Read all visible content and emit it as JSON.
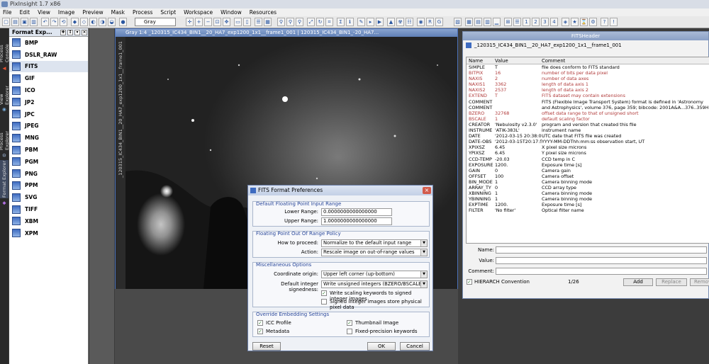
{
  "app": {
    "title": "PixInsight 1.7 x86"
  },
  "menu": [
    "File",
    "Edit",
    "View",
    "Image",
    "Preview",
    "Mask",
    "Process",
    "Script",
    "Workspace",
    "Window",
    "Resources"
  ],
  "toolbar": {
    "view_selector": "Gray"
  },
  "side_tabs": [
    "Process Console",
    "View Explorer",
    "Process Explorer",
    "Format Explorer"
  ],
  "format_explorer": {
    "title": "Format Exp...",
    "items": [
      "BMP",
      "DSLR_RAW",
      "FITS",
      "GIF",
      "ICO",
      "JP2",
      "JPC",
      "JPEG",
      "MNG",
      "PBM",
      "PGM",
      "PNG",
      "PPM",
      "SVG",
      "TIFF",
      "XBM",
      "XPM"
    ],
    "selected": "FITS"
  },
  "image_window": {
    "title": "Gray 1:4 _120315_IC434_BIN1__20_HA7_exp1200_1x1__frame1_001 | 120315_IC434_BIN1_-20_HA7...",
    "side_label": "_120315_IC434_BIN1__20_HA7_exp1200_1x1__frame1_001"
  },
  "fits_header": {
    "title": "FITSHeader",
    "file": "_120315_IC434_BIN1__20_HA7_exp1200_1x1__frame1_001",
    "columns": [
      "Name",
      "Value",
      "Comment"
    ],
    "rows": [
      {
        "name": "SIMPLE",
        "value": "T",
        "comment": "file does conform to FITS standard",
        "reserved": false
      },
      {
        "name": "BITPIX",
        "value": "16",
        "comment": "number of bits per data pixel",
        "reserved": true
      },
      {
        "name": "NAXIS",
        "value": "2",
        "comment": "number of data axes",
        "reserved": true
      },
      {
        "name": "NAXIS1",
        "value": "3362",
        "comment": "length of data axis 1",
        "reserved": true
      },
      {
        "name": "NAXIS2",
        "value": "2537",
        "comment": "length of data axis 2",
        "reserved": true
      },
      {
        "name": "EXTEND",
        "value": "T",
        "comment": "FITS dataset may contain extensions",
        "reserved": true
      },
      {
        "name": "COMMENT",
        "value": "",
        "comment": "FITS (Flexible Image Transport System) format is defined in 'Astronomy",
        "reserved": false
      },
      {
        "name": "COMMENT",
        "value": "",
        "comment": "and Astrophysics', volume 376, page 359; bibcode: 2001A&A...376..359H",
        "reserved": false
      },
      {
        "name": "BZERO",
        "value": "32768",
        "comment": "offset data range to that of unsigned short",
        "reserved": true
      },
      {
        "name": "BSCALE",
        "value": "1",
        "comment": "default scaling factor",
        "reserved": true
      },
      {
        "name": "CREATOR",
        "value": "'Nebulosity v2.3.0'",
        "comment": "program and version that created this file",
        "reserved": false
      },
      {
        "name": "INSTRUME",
        "value": "'ATIK-383L'",
        "comment": "instrument name",
        "reserved": false
      },
      {
        "name": "DATE",
        "value": "'2012-03-15 20:38:05'",
        "comment": "UTC date that FITS file was created",
        "reserved": false
      },
      {
        "name": "DATE-OBS",
        "value": "'2012-03-15T20:17:54'",
        "comment": "YYYY-MM-DDThh:mm:ss observation start, UT",
        "reserved": false
      },
      {
        "name": "XPIXSZ",
        "value": "6.45",
        "comment": "X pixel size microns",
        "reserved": false
      },
      {
        "name": "YPIXSZ",
        "value": "6.45",
        "comment": "Y pixel size microns",
        "reserved": false
      },
      {
        "name": "CCD-TEMP",
        "value": "-20.03",
        "comment": "CCD temp in C",
        "reserved": false
      },
      {
        "name": "EXPOSURE",
        "value": "1200.",
        "comment": "Exposure time [s]",
        "reserved": false
      },
      {
        "name": "GAIN",
        "value": "0",
        "comment": "Camera gain",
        "reserved": false
      },
      {
        "name": "OFFSET",
        "value": "100",
        "comment": "Camera offset",
        "reserved": false
      },
      {
        "name": "BIN_MODE",
        "value": "1",
        "comment": "Camera binning mode",
        "reserved": false
      },
      {
        "name": "ARRAY_TY",
        "value": "0",
        "comment": "CCD array type",
        "reserved": false
      },
      {
        "name": "XBINNING",
        "value": "1",
        "comment": "Camera binning mode",
        "reserved": false
      },
      {
        "name": "YBINNING",
        "value": "1",
        "comment": "Camera binning mode",
        "reserved": false
      },
      {
        "name": "EXPTIME",
        "value": "1200.",
        "comment": "Exposure time [s]",
        "reserved": false
      },
      {
        "name": "FILTER",
        "value": "'No filter'",
        "comment": "Optical filter name",
        "reserved": false
      }
    ],
    "name_label": "Name:",
    "value_label": "Value:",
    "comment_label": "Comment:",
    "hierarch_label": "HIERARCH Convention",
    "hierarch_checked": true,
    "page": "1/26",
    "add_label": "Add",
    "replace_label": "Replace",
    "remove_label": "Remov"
  },
  "prefs": {
    "title": "FITS Format Preferences",
    "float_input": {
      "title": "Default Floating Point Input Range",
      "lower_label": "Lower Range:",
      "lower_value": "0.0000000000000000",
      "upper_label": "Upper Range:",
      "upper_value": "1.0000000000000000"
    },
    "out_of_range": {
      "title": "Floating Point Out Of Range Policy",
      "proceed_label": "How to proceed:",
      "proceed_value": "Normalize to the default input range",
      "action_label": "Action:",
      "action_value": "Rescale image on out-of-range values"
    },
    "misc": {
      "title": "Miscellaneous Options",
      "origin_label": "Coordinate origin:",
      "origin_value": "Upper left corner (up-bottom)",
      "signed_label": "Default integer signedness:",
      "signed_value": "Write unsigned integers (BZERO/BSCALE)",
      "write_scaling_label": "Write scaling keywords to signed integer images",
      "write_scaling_checked": true,
      "signed_physical_label": "Signed integer images store physical pixel data",
      "signed_physical_checked": false
    },
    "embedding": {
      "title": "Override Embedding Settings",
      "icc_label": "ICC Profile",
      "icc_checked": true,
      "thumb_label": "Thumbnail Image",
      "thumb_checked": true,
      "meta_label": "Metadata",
      "meta_checked": true,
      "fixed_label": "Fixed-precision keywords",
      "fixed_checked": false
    },
    "reset_label": "Reset",
    "ok_label": "OK",
    "cancel_label": "Cancel"
  }
}
